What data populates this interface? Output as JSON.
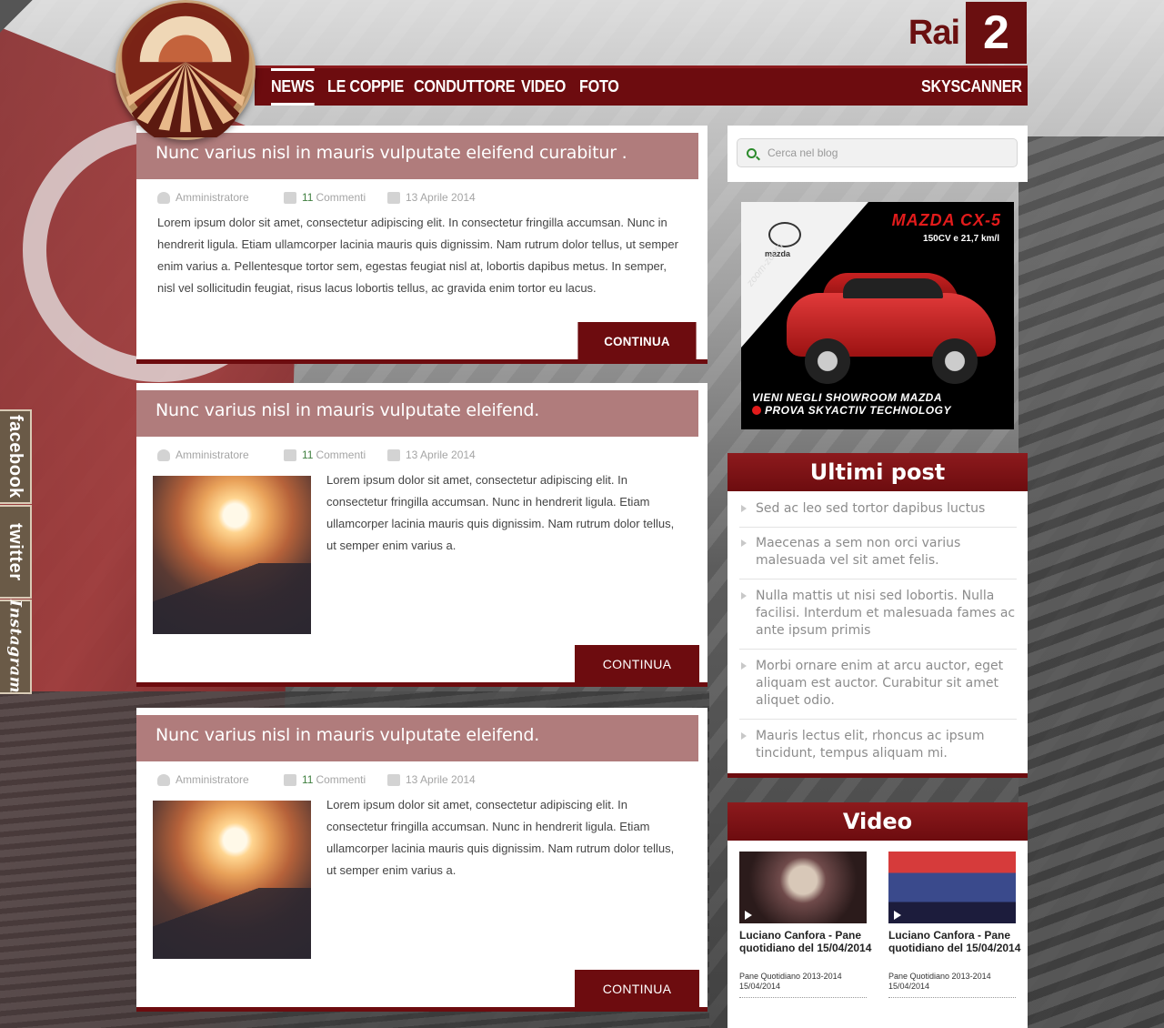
{
  "header": {
    "channel_word": "Rai",
    "channel_number": "2"
  },
  "nav": {
    "items": [
      "NEWS",
      "LE COPPIE",
      "CONDUTTORE",
      "VIDEO",
      "FOTO"
    ],
    "right": "SKYSCANNER"
  },
  "social": [
    "facebook",
    "twitter",
    "Instagram"
  ],
  "posts": [
    {
      "title": "Nunc varius nisl in mauris vulputate eleifend curabitur .",
      "author": "Amministratore",
      "comments_count": "11",
      "comments_label": "Commenti",
      "date": "13 Aprile 2014",
      "body": "Lorem ipsum dolor sit amet, consectetur adipiscing elit. In consectetur fringilla accumsan. Nunc in hendrerit ligula. Etiam ullamcorper lacinia mauris quis dignissim. Nam rutrum dolor tellus, ut semper enim varius a. Pellentesque tortor sem, egestas feugiat nisl at, lobortis dapibus metus. In semper, nisl vel sollicitudin feugiat, risus lacus lobortis tellus, ac gravida enim tortor eu lacus.",
      "button": "CONTINUA"
    },
    {
      "title": "Nunc varius nisl in mauris vulputate eleifend.",
      "author": "Amministratore",
      "comments_count": "11",
      "comments_label": "Commenti",
      "date": "13 Aprile 2014",
      "body": "Lorem ipsum dolor sit amet, consectetur adipiscing elit. In consectetur fringilla accumsan. Nunc in hendrerit ligula. Etiam ullamcorper lacinia mauris quis dignissim. Nam rutrum dolor tellus, ut semper enim varius a.",
      "button": "CONTINUA"
    },
    {
      "title": "Nunc varius nisl in mauris vulputate eleifend.",
      "author": "Amministratore",
      "comments_count": "11",
      "comments_label": "Commenti",
      "date": "13 Aprile 2014",
      "body": "Lorem ipsum dolor sit amet, consectetur adipiscing elit. In consectetur fringilla accumsan. Nunc in hendrerit ligula. Etiam ullamcorper lacinia mauris quis dignissim. Nam rutrum dolor tellus, ut semper enim varius a.",
      "button": "CONTINUA"
    }
  ],
  "search": {
    "placeholder": "Cerca nel blog"
  },
  "ad": {
    "title": "MAZDA CX-5",
    "subtitle": "150CV e 21,7 km/l",
    "brand": "mazda",
    "tagline_rotated": "zoom-zoom",
    "line1": "VIENI NEGLI SHOWROOM MAZDA",
    "line2": "PROVA SKYACTIV TECHNOLOGY"
  },
  "latest_posts": {
    "title": "Ultimi post",
    "items": [
      "Sed ac leo sed tortor dapibus luctus",
      "Maecenas a sem non orci varius malesuada vel sit amet felis.",
      "Nulla mattis ut nisi sed lobortis. Nulla facilisi. Interdum et malesuada fames ac ante ipsum primis",
      "Morbi ornare enim at arcu auctor, eget aliquam est auctor. Curabitur sit amet aliquet odio.",
      "Mauris lectus elit, rhoncus ac ipsum tincidunt, tempus aliquam mi."
    ]
  },
  "video": {
    "title": "Video",
    "items": [
      {
        "title": "Luciano Canfora - Pane quotidiano del 15/04/2014",
        "sub": "Pane Quotidiano 2013-2014",
        "date": "15/04/2014"
      },
      {
        "title": "Luciano Canfora - Pane quotidiano del 15/04/2014",
        "sub": "Pane Quotidiano 2013-2014",
        "date": "15/04/2014"
      }
    ]
  },
  "colors": {
    "brand_red": "#6d0c0f",
    "title_bar": "#b07c7c"
  }
}
